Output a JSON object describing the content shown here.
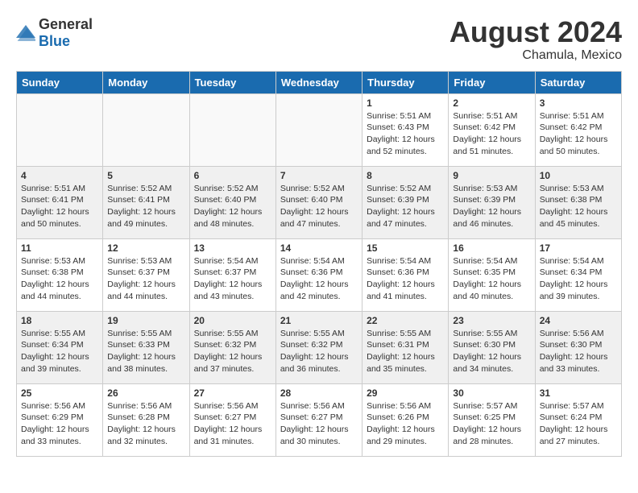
{
  "header": {
    "logo_general": "General",
    "logo_blue": "Blue",
    "month_year": "August 2024",
    "location": "Chamula, Mexico"
  },
  "weekdays": [
    "Sunday",
    "Monday",
    "Tuesday",
    "Wednesday",
    "Thursday",
    "Friday",
    "Saturday"
  ],
  "weeks": [
    [
      {
        "day": "",
        "info": ""
      },
      {
        "day": "",
        "info": ""
      },
      {
        "day": "",
        "info": ""
      },
      {
        "day": "",
        "info": ""
      },
      {
        "day": "1",
        "info": "Sunrise: 5:51 AM\nSunset: 6:43 PM\nDaylight: 12 hours\nand 52 minutes."
      },
      {
        "day": "2",
        "info": "Sunrise: 5:51 AM\nSunset: 6:42 PM\nDaylight: 12 hours\nand 51 minutes."
      },
      {
        "day": "3",
        "info": "Sunrise: 5:51 AM\nSunset: 6:42 PM\nDaylight: 12 hours\nand 50 minutes."
      }
    ],
    [
      {
        "day": "4",
        "info": "Sunrise: 5:51 AM\nSunset: 6:41 PM\nDaylight: 12 hours\nand 50 minutes."
      },
      {
        "day": "5",
        "info": "Sunrise: 5:52 AM\nSunset: 6:41 PM\nDaylight: 12 hours\nand 49 minutes."
      },
      {
        "day": "6",
        "info": "Sunrise: 5:52 AM\nSunset: 6:40 PM\nDaylight: 12 hours\nand 48 minutes."
      },
      {
        "day": "7",
        "info": "Sunrise: 5:52 AM\nSunset: 6:40 PM\nDaylight: 12 hours\nand 47 minutes."
      },
      {
        "day": "8",
        "info": "Sunrise: 5:52 AM\nSunset: 6:39 PM\nDaylight: 12 hours\nand 47 minutes."
      },
      {
        "day": "9",
        "info": "Sunrise: 5:53 AM\nSunset: 6:39 PM\nDaylight: 12 hours\nand 46 minutes."
      },
      {
        "day": "10",
        "info": "Sunrise: 5:53 AM\nSunset: 6:38 PM\nDaylight: 12 hours\nand 45 minutes."
      }
    ],
    [
      {
        "day": "11",
        "info": "Sunrise: 5:53 AM\nSunset: 6:38 PM\nDaylight: 12 hours\nand 44 minutes."
      },
      {
        "day": "12",
        "info": "Sunrise: 5:53 AM\nSunset: 6:37 PM\nDaylight: 12 hours\nand 44 minutes."
      },
      {
        "day": "13",
        "info": "Sunrise: 5:54 AM\nSunset: 6:37 PM\nDaylight: 12 hours\nand 43 minutes."
      },
      {
        "day": "14",
        "info": "Sunrise: 5:54 AM\nSunset: 6:36 PM\nDaylight: 12 hours\nand 42 minutes."
      },
      {
        "day": "15",
        "info": "Sunrise: 5:54 AM\nSunset: 6:36 PM\nDaylight: 12 hours\nand 41 minutes."
      },
      {
        "day": "16",
        "info": "Sunrise: 5:54 AM\nSunset: 6:35 PM\nDaylight: 12 hours\nand 40 minutes."
      },
      {
        "day": "17",
        "info": "Sunrise: 5:54 AM\nSunset: 6:34 PM\nDaylight: 12 hours\nand 39 minutes."
      }
    ],
    [
      {
        "day": "18",
        "info": "Sunrise: 5:55 AM\nSunset: 6:34 PM\nDaylight: 12 hours\nand 39 minutes."
      },
      {
        "day": "19",
        "info": "Sunrise: 5:55 AM\nSunset: 6:33 PM\nDaylight: 12 hours\nand 38 minutes."
      },
      {
        "day": "20",
        "info": "Sunrise: 5:55 AM\nSunset: 6:32 PM\nDaylight: 12 hours\nand 37 minutes."
      },
      {
        "day": "21",
        "info": "Sunrise: 5:55 AM\nSunset: 6:32 PM\nDaylight: 12 hours\nand 36 minutes."
      },
      {
        "day": "22",
        "info": "Sunrise: 5:55 AM\nSunset: 6:31 PM\nDaylight: 12 hours\nand 35 minutes."
      },
      {
        "day": "23",
        "info": "Sunrise: 5:55 AM\nSunset: 6:30 PM\nDaylight: 12 hours\nand 34 minutes."
      },
      {
        "day": "24",
        "info": "Sunrise: 5:56 AM\nSunset: 6:30 PM\nDaylight: 12 hours\nand 33 minutes."
      }
    ],
    [
      {
        "day": "25",
        "info": "Sunrise: 5:56 AM\nSunset: 6:29 PM\nDaylight: 12 hours\nand 33 minutes."
      },
      {
        "day": "26",
        "info": "Sunrise: 5:56 AM\nSunset: 6:28 PM\nDaylight: 12 hours\nand 32 minutes."
      },
      {
        "day": "27",
        "info": "Sunrise: 5:56 AM\nSunset: 6:27 PM\nDaylight: 12 hours\nand 31 minutes."
      },
      {
        "day": "28",
        "info": "Sunrise: 5:56 AM\nSunset: 6:27 PM\nDaylight: 12 hours\nand 30 minutes."
      },
      {
        "day": "29",
        "info": "Sunrise: 5:56 AM\nSunset: 6:26 PM\nDaylight: 12 hours\nand 29 minutes."
      },
      {
        "day": "30",
        "info": "Sunrise: 5:57 AM\nSunset: 6:25 PM\nDaylight: 12 hours\nand 28 minutes."
      },
      {
        "day": "31",
        "info": "Sunrise: 5:57 AM\nSunset: 6:24 PM\nDaylight: 12 hours\nand 27 minutes."
      }
    ]
  ]
}
